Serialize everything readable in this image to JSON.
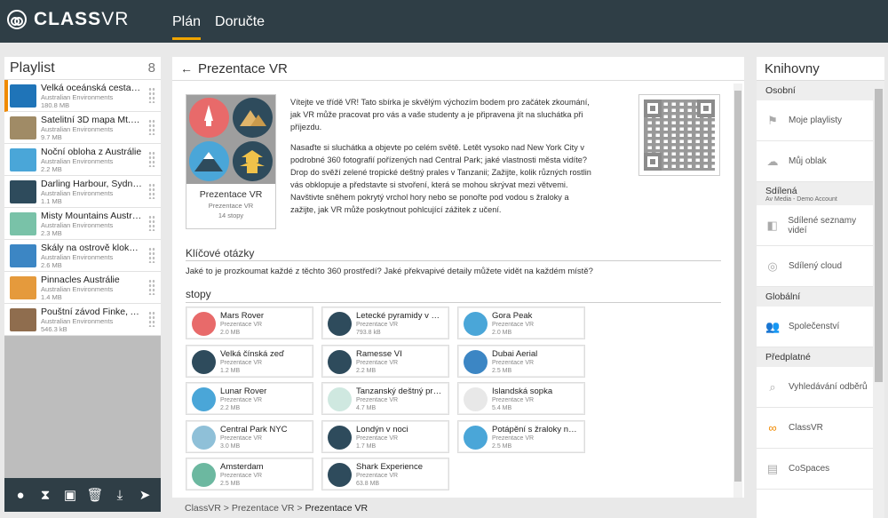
{
  "app": {
    "logo_main": "CLASS",
    "logo_sub": "VR"
  },
  "nav": {
    "plan": "Plán",
    "deliver": "Doručte"
  },
  "playlist": {
    "title": "Playlist",
    "count": "8",
    "items": [
      {
        "title": "Velká oceánská cesta, Vic...",
        "sub": "Australian Environments",
        "size": "180.8 MB",
        "color": "#1f74b8"
      },
      {
        "title": "Satelitní 3D mapa Mt. Ko...",
        "sub": "Australian Environments",
        "size": "9.7 MB",
        "color": "#a08b66"
      },
      {
        "title": "Noční obloha z Austrálie",
        "sub": "Australian Environments",
        "size": "2.2 MB",
        "color": "#4aa6d8"
      },
      {
        "title": "Darling Harbour, Sydney",
        "sub": "Australian Environments",
        "size": "1.1 MB",
        "color": "#2e4b5c"
      },
      {
        "title": "Misty Mountains Austrálie",
        "sub": "Australian Environments",
        "size": "2.3 MB",
        "color": "#79c2a8"
      },
      {
        "title": "Skály na ostrově klokanů",
        "sub": "Australian Environments",
        "size": "2.6 MB",
        "color": "#3c86c4"
      },
      {
        "title": "Pinnacles Austrálie",
        "sub": "Australian Environments",
        "size": "1.4 MB",
        "color": "#e59a3c"
      },
      {
        "title": "Pouštní závod Finke, Aust...",
        "sub": "Australian Environments",
        "size": "546.3 kB",
        "color": "#8f6d4e"
      }
    ]
  },
  "main": {
    "title": "Prezentace VR",
    "card_title": "Prezentace VR",
    "card_sub": "Prezentace VR",
    "card_count": "14 stopy",
    "para1": "Vítejte ve třídě VR! Tato sbírka je skvělým výchozím bodem pro začátek zkoumání, jak VR může pracovat pro vás a vaše studenty a je připravena jít na sluchátka při příjezdu.",
    "para2": "Nasaďte si sluchátka a objevte po celém světě. Letět vysoko nad New York City v podrobné 360 fotografií pořízených nad Central Park; jaké vlastnosti města vidíte? Drop do svěží zelené tropické deštný prales v Tanzanii; Zažijte, kolik různých rostlin vás obklopuje a představte si stvoření, která se mohou skrývat mezi větvemi. Navštivte sněhem pokrytý vrchol hory nebo se ponořte pod vodou s žraloky a zažijte, jak VR může poskytnout pohlcující zážitek z učení.",
    "key_questions_title": "Klíčové otázky",
    "question": "Jaké to je prozkoumat každé z těchto 360 prostředí? Jaké překvapivé detaily můžete vidět na každém místě?",
    "tracks_title": "stopy",
    "tracks": [
      {
        "title": "Mars Rover",
        "sub": "Prezentace VR",
        "size": "2.0 MB",
        "color": "#e86a6a"
      },
      {
        "title": "Letecké pyramidy v Gí...",
        "sub": "Prezentace VR",
        "size": "793.8 kB",
        "color": "#2e4b5c"
      },
      {
        "title": "Gora Peak",
        "sub": "Prezentace VR",
        "size": "2.0 MB",
        "color": "#4aa6d8"
      },
      {
        "title": "Velká čínská zeď",
        "sub": "Prezentace VR",
        "size": "1.2 MB",
        "color": "#2e4b5c"
      },
      {
        "title": "Ramesse VI",
        "sub": "Prezentace VR",
        "size": "2.2 MB",
        "color": "#2e4b5c"
      },
      {
        "title": "Dubai Aerial",
        "sub": "Prezentace VR",
        "size": "2.5 MB",
        "color": "#3c86c4"
      },
      {
        "title": "Lunar Rover",
        "sub": "Prezentace VR",
        "size": "2.2 MB",
        "color": "#4aa6d8"
      },
      {
        "title": "Tanzanský deštný pral...",
        "sub": "Prezentace VR",
        "size": "4.7 MB",
        "color": "#cfe8e0"
      },
      {
        "title": "Islandská sopka",
        "sub": "Prezentace VR",
        "size": "5.4 MB",
        "color": "#e8e8e8"
      },
      {
        "title": "Central Park NYC",
        "sub": "Prezentace VR",
        "size": "3.0 MB",
        "color": "#8fc0d8"
      },
      {
        "title": "Londýn v noci",
        "sub": "Prezentace VR",
        "size": "1.7 MB",
        "color": "#2e4b5c"
      },
      {
        "title": "Potápění s žraloky na ...",
        "sub": "Prezentace VR",
        "size": "2.5 MB",
        "color": "#4aa6d8"
      },
      {
        "title": "Amsterdam",
        "sub": "Prezentace VR",
        "size": "2.5 MB",
        "color": "#6cb8a0"
      },
      {
        "title": "Shark Experience",
        "sub": "Prezentace VR",
        "size": "63.8 MB",
        "color": "#2e4b5c"
      }
    ]
  },
  "breadcrumb": {
    "a": "ClassVR",
    "b": "Prezentace VR",
    "c": "Prezentace VR",
    "sep": ">"
  },
  "libraries": {
    "title": "Knihovny",
    "personal": "Osobní",
    "my_playlists": "Moje playlisty",
    "my_cloud": "Můj oblak",
    "shared": "Sdílená",
    "shared_sub": "Av Media - Demo Account",
    "shared_playlists": "Sdílené seznamy videí",
    "shared_cloud": "Sdílený cloud",
    "global": "Globální",
    "community": "Společenství",
    "subscription": "Předplatné",
    "search_subs": "Vyhledávání odběrů",
    "classvr": "ClassVR",
    "cospaces": "CoSpaces"
  }
}
